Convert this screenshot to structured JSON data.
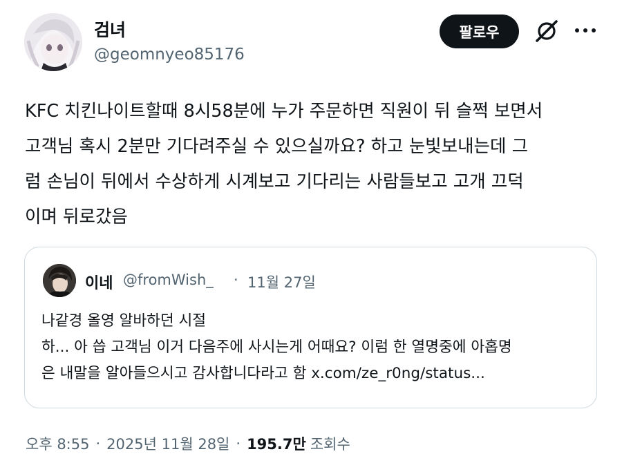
{
  "author": {
    "name": "검녀",
    "handle": "@geomnyeo85176"
  },
  "header": {
    "follow_label": "팔로우",
    "grok_icon": "grok-icon",
    "more_icon": "more-icon"
  },
  "tweet": {
    "text": "KFC 치킨나이트할때 8시58분에 누가 주문하면 직원이 뒤 슬쩍 보면서\n고객님 혹시 2분만 기다려주실 수 있으실까요? 하고 눈빛보내는데 그\n럼 손님이 뒤에서 수상하게 시계보고 기다리는 사람들보고 고개 끄덕\n이며 뒤로갔음"
  },
  "quote": {
    "name": "이네",
    "handle": "@fromWish_",
    "separator": "·",
    "date": "11월 27일",
    "text": "나같경 올영 알바하던 시절\n하... 아 씁 고객님 이거 다음주에 사시는게 어때요? 이럼 한 열명중에 아홉명\n은 내말을 알아들으시고 감사합니다라고 함 x.com/ze_r0ng/status..."
  },
  "meta": {
    "time": "오후 8:55",
    "dot1": "·",
    "date": "2025년 11월 28일",
    "dot2": "·",
    "views": "195.7만",
    "views_label": "조회수"
  }
}
